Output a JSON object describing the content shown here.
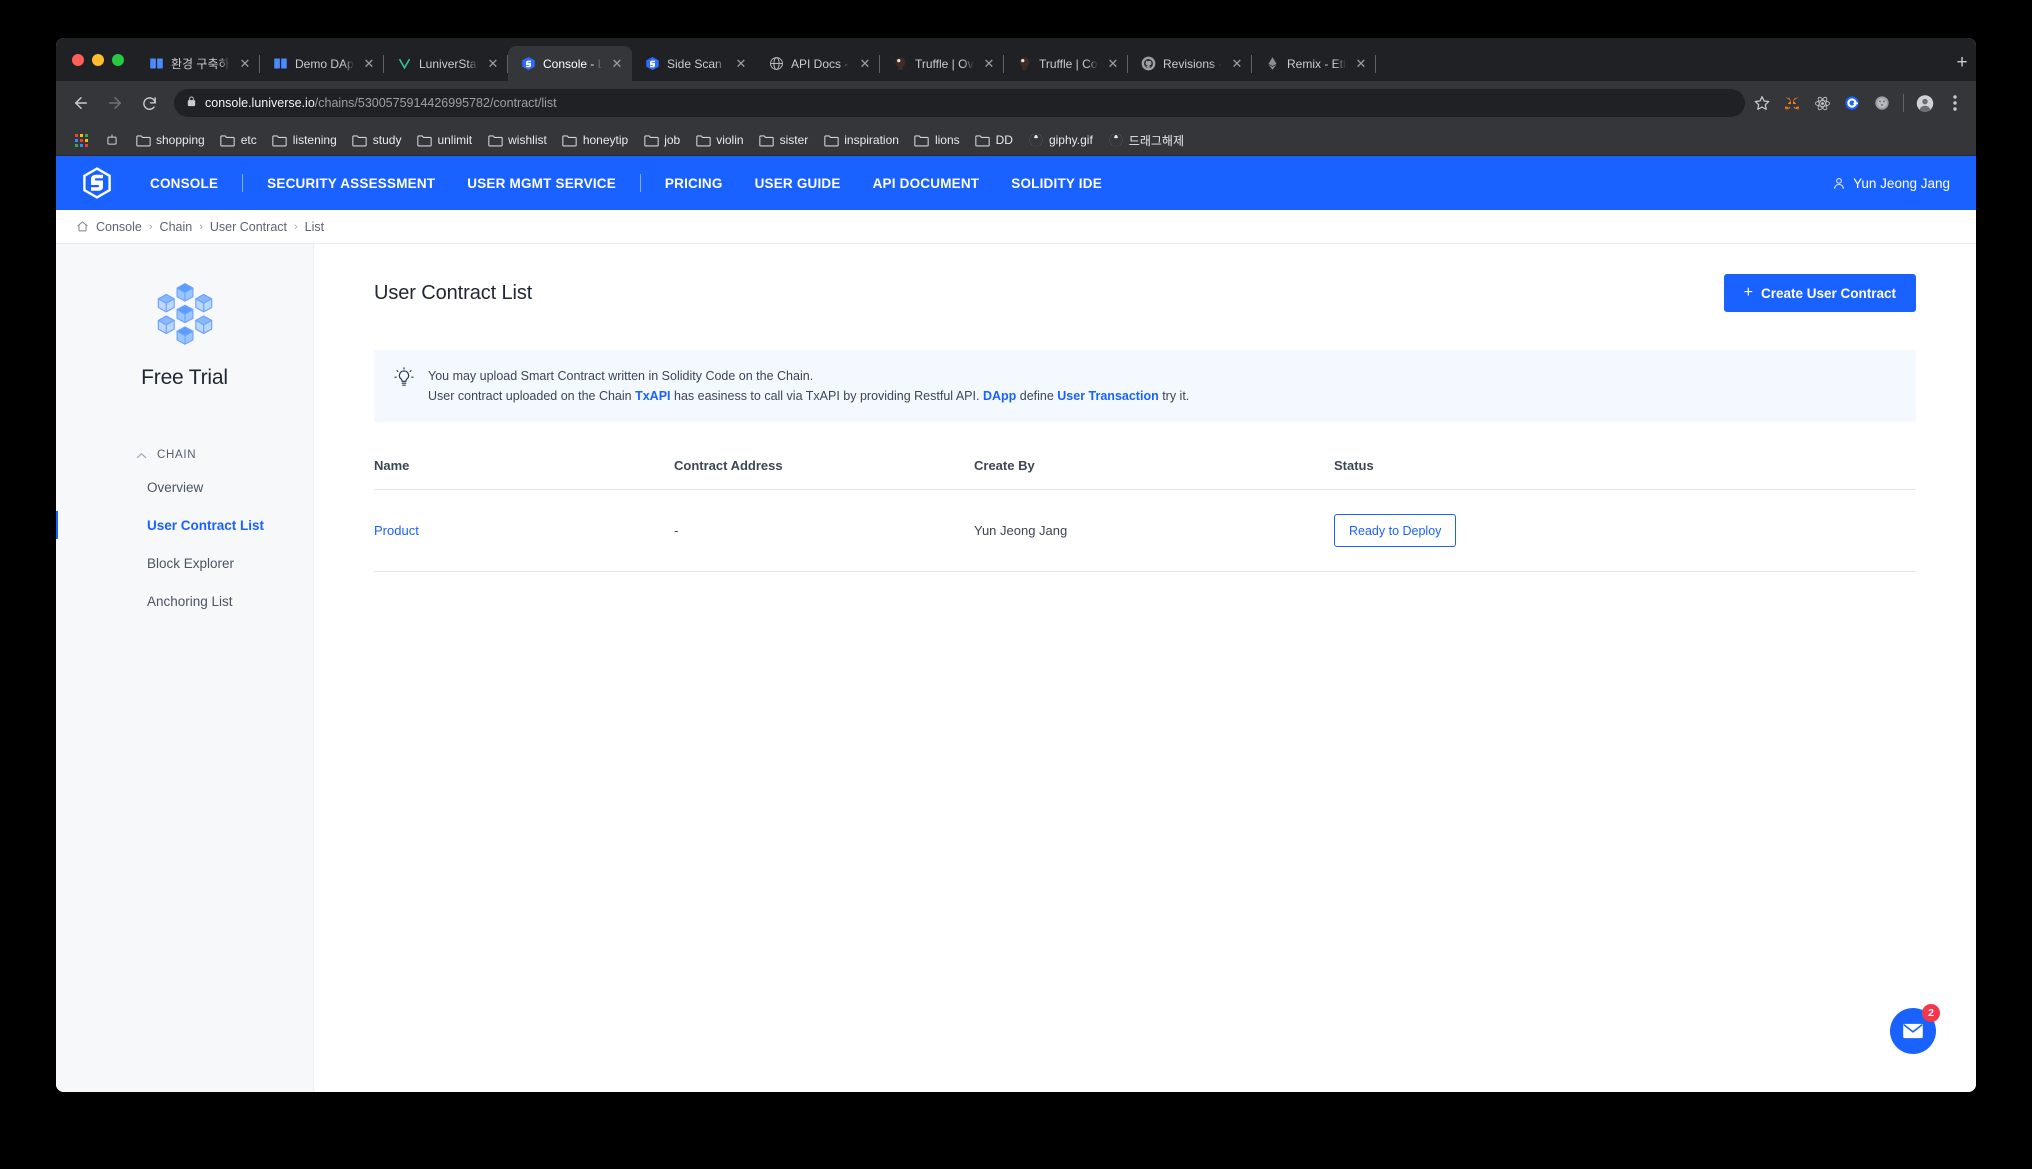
{
  "browser": {
    "tabs": [
      {
        "title": "환경 구축하기",
        "favicon": "book-icon",
        "active": false
      },
      {
        "title": "Demo DApp 체험하기",
        "favicon": "book-icon",
        "active": false
      },
      {
        "title": "LuniverStar K",
        "favicon": "v-icon",
        "active": false
      },
      {
        "title": "Console - Luniverse",
        "favicon": "luniverse-icon",
        "active": true
      },
      {
        "title": "Side Scan - Luniverse",
        "favicon": "luniverse-icon",
        "active": false
      },
      {
        "title": "API Docs - Luniverse",
        "favicon": "globe-icon",
        "active": false
      },
      {
        "title": "Truffle | Overview |",
        "favicon": "truffle-icon",
        "active": false
      },
      {
        "title": "Truffle | Configuration",
        "favicon": "truffle-icon",
        "active": false
      },
      {
        "title": "Revisions · Created",
        "favicon": "github-icon",
        "active": false
      },
      {
        "title": "Remix - Ethereum IDE",
        "favicon": "ethereum-icon",
        "active": false
      }
    ],
    "new_tab_label": "+",
    "nav": {
      "back": "←",
      "forward": "→",
      "reload": "⟳"
    },
    "url": {
      "lock": "🔒",
      "host": "console.luniverse.io",
      "path": "/chains/5300575914426995782/contract/list"
    },
    "toolbar_icons": [
      "star-icon",
      "metamask-icon",
      "react-devtools-icon",
      "extension-icon",
      "extension-alt-icon",
      "profile-icon",
      "menu-icon"
    ],
    "bookmarks": [
      {
        "label": "",
        "icon": "apps-grid-icon"
      },
      {
        "label": "",
        "icon": "korean-app-icon"
      },
      {
        "label": "shopping",
        "icon": "folder-icon"
      },
      {
        "label": "etc",
        "icon": "folder-icon"
      },
      {
        "label": "listening",
        "icon": "folder-icon"
      },
      {
        "label": "study",
        "icon": "folder-icon"
      },
      {
        "label": "unlimit",
        "icon": "folder-icon"
      },
      {
        "label": "wishlist",
        "icon": "folder-icon"
      },
      {
        "label": "honeytip",
        "icon": "folder-icon"
      },
      {
        "label": "job",
        "icon": "folder-icon"
      },
      {
        "label": "violin",
        "icon": "folder-icon"
      },
      {
        "label": "sister",
        "icon": "folder-icon"
      },
      {
        "label": "inspiration",
        "icon": "folder-icon"
      },
      {
        "label": "lions",
        "icon": "folder-icon"
      },
      {
        "label": "DD",
        "icon": "folder-icon"
      },
      {
        "label": "giphy.gif",
        "icon": "globe-bookmark-icon"
      },
      {
        "label": "드래그해제",
        "icon": "globe-bookmark-icon"
      }
    ]
  },
  "topnav": {
    "logo": "luniverse-logo",
    "links": [
      {
        "label": "CONSOLE",
        "sep_after": true
      },
      {
        "label": "SECURITY ASSESSMENT",
        "sep_after": false
      },
      {
        "label": "USER MGMT SERVICE",
        "sep_after": true
      },
      {
        "label": "PRICING",
        "sep_after": false
      },
      {
        "label": "USER GUIDE",
        "sep_after": false
      },
      {
        "label": "API DOCUMENT",
        "sep_after": false
      },
      {
        "label": "SOLIDITY IDE",
        "sep_after": false
      }
    ],
    "user": "Yun Jeong Jang",
    "accent": "#1a62ff"
  },
  "breadcrumb": {
    "home_icon": "home-icon",
    "items": [
      "Console",
      "Chain",
      "User Contract",
      "List"
    ],
    "separator": "›"
  },
  "sidebar": {
    "plan_logo": "cube-cluster-icon",
    "plan_name": "Free Trial",
    "group": {
      "label": "CHAIN",
      "collapse_icon": "chevron-up-icon"
    },
    "items": [
      {
        "label": "Overview",
        "active": false
      },
      {
        "label": "User Contract List",
        "active": true
      },
      {
        "label": "Block Explorer",
        "active": false
      },
      {
        "label": "Anchoring List",
        "active": false
      }
    ]
  },
  "main": {
    "title": "User Contract List",
    "create_button": {
      "plus": "+",
      "label": "Create User Contract"
    },
    "notice": {
      "icon": "lightbulb-icon",
      "line1": "You may upload Smart Contract written in Solidity Code on the Chain.",
      "line2_a": "User contract uploaded on the Chain ",
      "link1": "TxAPI",
      "line2_b": " has easiness to call via TxAPI by providing Restful API. ",
      "link2": "DApp",
      "line2_c": " define ",
      "link3": "User Transaction",
      "line2_d": " try it."
    },
    "table": {
      "columns": [
        "Name",
        "Contract Address",
        "Create By",
        "Status"
      ],
      "rows": [
        {
          "name": "Product",
          "address": "-",
          "created_by": "Yun Jeong Jang",
          "status": "Ready to Deploy"
        }
      ]
    },
    "fab": {
      "icon": "mail-icon",
      "badge": "2"
    }
  }
}
